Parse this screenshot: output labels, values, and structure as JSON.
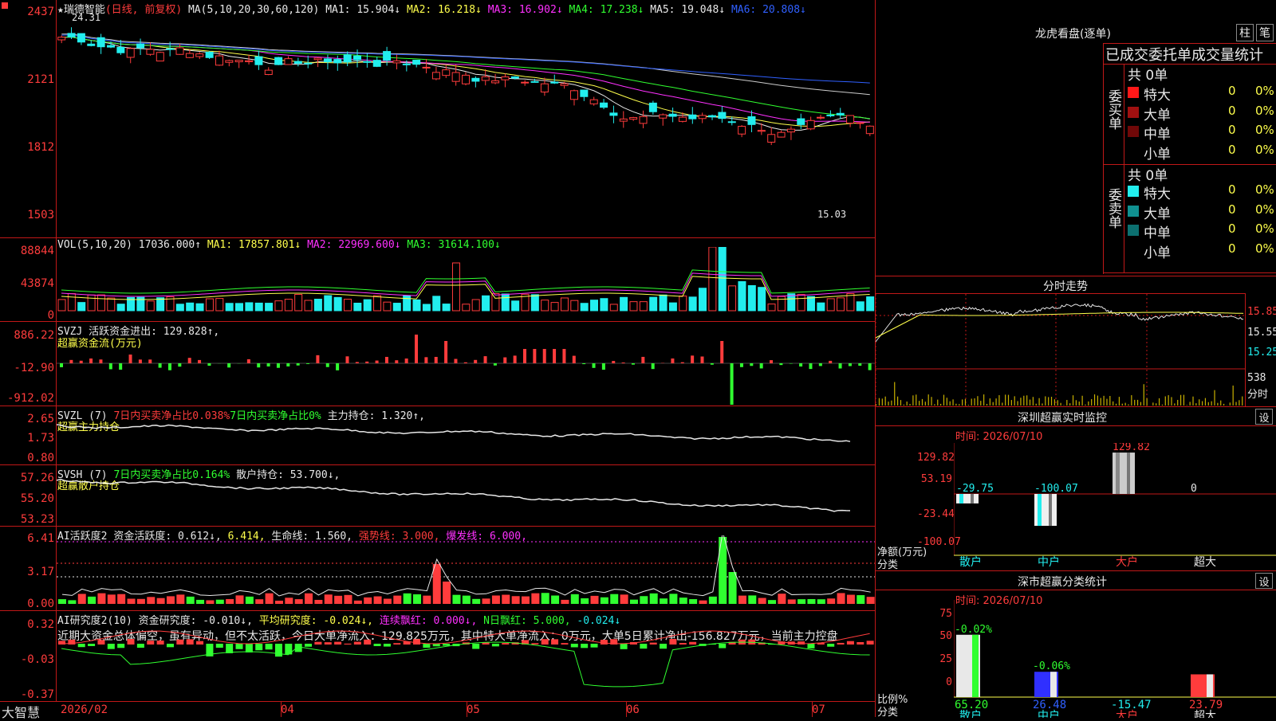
{
  "stock": {
    "name": "瑞德智能",
    "period_label": "(日线, 前复权)",
    "high_label": "24.31",
    "low_label": "15.03"
  },
  "price_axis": [
    "2437",
    "2121",
    "1812",
    "1503"
  ],
  "ma_header": {
    "label": "MA(5,10,20,30,60,120)",
    "ma1": "MA1: 15.904↓",
    "ma2": "MA2: 16.218↓",
    "ma3": "MA3: 16.902↓",
    "ma4": "MA4: 17.238↓",
    "ma5": "MA5: 19.048↓",
    "ma6": "MA6: 20.808↓"
  },
  "vol": {
    "axis": [
      "88844",
      "43874",
      "0"
    ],
    "label": "VOL(5,10,20)",
    "val": "17036.000↑",
    "ma1": "MA1: 17857.801↓",
    "ma2": "MA2: 22969.600↓",
    "ma3": "MA3: 31614.100↓"
  },
  "svzj": {
    "axis": [
      "886.22",
      "-12.90",
      "-912.02"
    ],
    "label": "SVZJ 活跃资金进出: 129.828↑,",
    "sub": "超赢资金流(万元)"
  },
  "svzl": {
    "axis": [
      "2.65",
      "1.73",
      "0.80"
    ],
    "l1": "SVZL (7)",
    "l2": "7日内买卖净占比0.038%",
    "l3": "7日内买卖净占比0%",
    "l4": "主力持仓: 1.320↑,",
    "sub": "超赢主力持仓"
  },
  "svsh": {
    "axis": [
      "57.26",
      "55.20",
      "53.23"
    ],
    "l1": "SVSH (7)",
    "l2": "7日内买卖净占比0.164%",
    "l3": "散户持仓: 53.700↓,",
    "sub": "超赢散户持仓"
  },
  "ai1": {
    "axis": [
      "6.41",
      "3.17",
      "0.00"
    ],
    "l1": "AI活跃度2",
    "l2": "资金活跃度: 0.612↓,",
    "l3": "6.414,",
    "l4": "生命线: 1.560,",
    "l5": "强势线: 3.000,",
    "l6": "爆发线: 6.000,"
  },
  "ai2": {
    "axis": [
      "0.32",
      "-0.03",
      "-0.37"
    ],
    "l1": "AI研究度2(10)",
    "l2": "资金研究度: -0.010↓,",
    "l3": "平均研究度: -0.024↓,",
    "l4": "连续飘红: 0.000↓,",
    "l5": "N日飘红: 5.000,",
    "l6": "-0.024↓",
    "comment": "近期大资金总体偏空，虽有异动，但不太活跃，今日大单净流入：129.825万元，其中特大单净流入：0万元，大单5日累计净出-156.827万元，当前主力控盘"
  },
  "date_axis": [
    "2026/02",
    "04",
    "05",
    "06",
    "07"
  ],
  "brand": "大智慧",
  "longhu": {
    "title": "龙虎看盘(逐单)",
    "btn1": "柱",
    "btn2": "笔",
    "subtitle": "已成交委托单成交量统计",
    "buy_label": "委买单",
    "sell_label": "委卖单",
    "buy_total": "共 0单",
    "sell_total": "共 0单",
    "buy_rows": [
      {
        "n": "特大",
        "v": "0",
        "p": "0%",
        "c": "#ff1818"
      },
      {
        "n": "大单",
        "v": "0",
        "p": "0%",
        "c": "#a01010"
      },
      {
        "n": "中单",
        "v": "0",
        "p": "0%",
        "c": "#700808"
      },
      {
        "n": "小单",
        "v": "0",
        "p": "0%",
        "c": "#000000"
      }
    ],
    "sell_rows": [
      {
        "n": "特大",
        "v": "0",
        "p": "0%",
        "c": "#22eeee"
      },
      {
        "n": "大单",
        "v": "0",
        "p": "0%",
        "c": "#109090"
      },
      {
        "n": "中单",
        "v": "0",
        "p": "0%",
        "c": "#0c7070"
      },
      {
        "n": "小单",
        "v": "0",
        "p": "0%",
        "c": "#000000"
      }
    ]
  },
  "fenshi": {
    "title": "分时走势",
    "axis": [
      "15.85",
      "15.55",
      "15.25"
    ],
    "vol": "538",
    "unit": "分时"
  },
  "monitor": {
    "title": "深圳超赢实时监控",
    "btn": "设",
    "date": "时间: 2026/07/10",
    "axis": [
      "129.82",
      "53.19",
      "-23.44",
      "-100.07"
    ],
    "ylabel": "净额(万元)",
    "xlabel": "分类",
    "cats": [
      "散户",
      "中户",
      "大户",
      "超大"
    ],
    "vals": [
      "-29.75",
      "-100.07",
      "129.82",
      "0"
    ]
  },
  "classify": {
    "title": "深市超赢分类统计",
    "btn": "设",
    "date": "时间: 2026/07/10",
    "axis": [
      "75",
      "50",
      "25",
      "0"
    ],
    "ylabel": "比例%",
    "xlabel": "分类",
    "cats": [
      "散户",
      "中户",
      "大户",
      "超大"
    ],
    "top": [
      "-0.02%",
      "-0.06%",
      "",
      ""
    ],
    "bottom": [
      "65.20",
      "26.48",
      "-15.47",
      "23.79"
    ]
  }
}
